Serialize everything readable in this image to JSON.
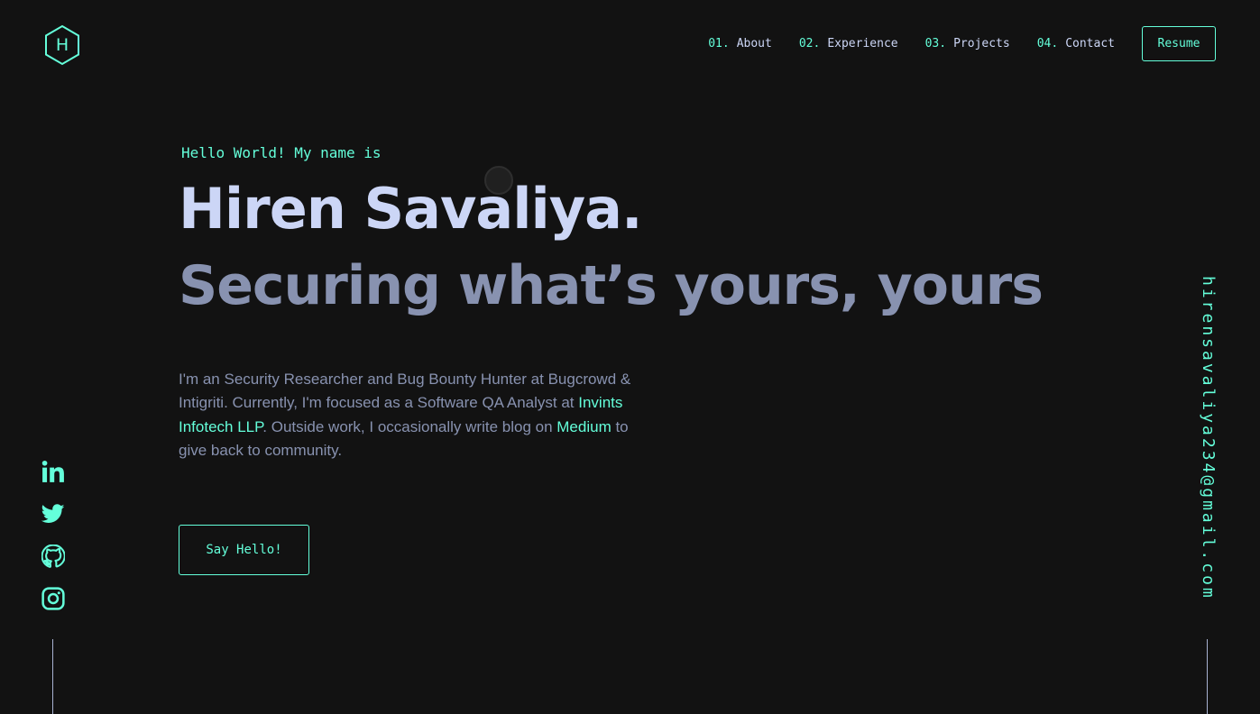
{
  "logo": {
    "letter": "H"
  },
  "nav": {
    "items": [
      {
        "num": "01.",
        "label": "About"
      },
      {
        "num": "02.",
        "label": "Experience"
      },
      {
        "num": "03.",
        "label": "Projects"
      },
      {
        "num": "04.",
        "label": "Contact"
      }
    ],
    "resume_label": "Resume"
  },
  "hero": {
    "greeting": "Hello World! My name is",
    "name": "Hiren Savaliya.",
    "tagline": "Securing what’s yours, yours",
    "about": {
      "part1": "I'm an Security Researcher and Bug Bounty Hunter at Bugcrowd & Intigriti. Currently, I'm focused as a Software QA Analyst at ",
      "company_link": "Invints Infotech LLP",
      "part2": ". Outside work, I occasionally write blog on ",
      "medium_link": "Medium",
      "part3": " to give back to community."
    },
    "cta_label": "Say Hello!"
  },
  "socials": [
    {
      "icon": "linkedin-icon"
    },
    {
      "icon": "twitter-icon"
    },
    {
      "icon": "github-icon"
    },
    {
      "icon": "instagram-icon"
    }
  ],
  "email": "hirensavaliya234@gmail.com",
  "colors": {
    "background": "#121212",
    "accent": "#64ffda",
    "heading": "#ccd6f6",
    "muted": "#8892b0"
  }
}
